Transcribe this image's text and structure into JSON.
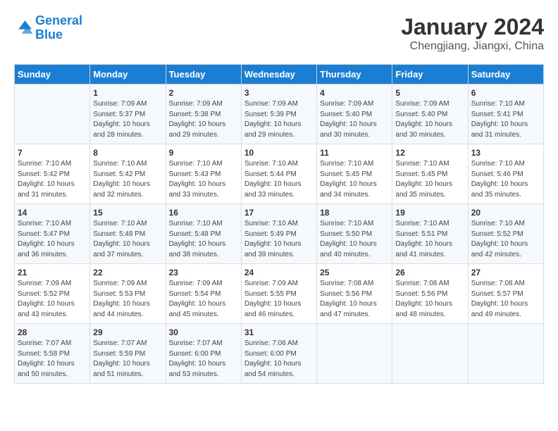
{
  "header": {
    "logo_line1": "General",
    "logo_line2": "Blue",
    "title": "January 2024",
    "subtitle": "Chengjiang, Jiangxi, China"
  },
  "weekdays": [
    "Sunday",
    "Monday",
    "Tuesday",
    "Wednesday",
    "Thursday",
    "Friday",
    "Saturday"
  ],
  "weeks": [
    [
      {
        "day": "",
        "content": ""
      },
      {
        "day": "1",
        "content": "Sunrise: 7:09 AM\nSunset: 5:37 PM\nDaylight: 10 hours\nand 28 minutes."
      },
      {
        "day": "2",
        "content": "Sunrise: 7:09 AM\nSunset: 5:38 PM\nDaylight: 10 hours\nand 29 minutes."
      },
      {
        "day": "3",
        "content": "Sunrise: 7:09 AM\nSunset: 5:39 PM\nDaylight: 10 hours\nand 29 minutes."
      },
      {
        "day": "4",
        "content": "Sunrise: 7:09 AM\nSunset: 5:40 PM\nDaylight: 10 hours\nand 30 minutes."
      },
      {
        "day": "5",
        "content": "Sunrise: 7:09 AM\nSunset: 5:40 PM\nDaylight: 10 hours\nand 30 minutes."
      },
      {
        "day": "6",
        "content": "Sunrise: 7:10 AM\nSunset: 5:41 PM\nDaylight: 10 hours\nand 31 minutes."
      }
    ],
    [
      {
        "day": "7",
        "content": "Sunrise: 7:10 AM\nSunset: 5:42 PM\nDaylight: 10 hours\nand 31 minutes."
      },
      {
        "day": "8",
        "content": "Sunrise: 7:10 AM\nSunset: 5:42 PM\nDaylight: 10 hours\nand 32 minutes."
      },
      {
        "day": "9",
        "content": "Sunrise: 7:10 AM\nSunset: 5:43 PM\nDaylight: 10 hours\nand 33 minutes."
      },
      {
        "day": "10",
        "content": "Sunrise: 7:10 AM\nSunset: 5:44 PM\nDaylight: 10 hours\nand 33 minutes."
      },
      {
        "day": "11",
        "content": "Sunrise: 7:10 AM\nSunset: 5:45 PM\nDaylight: 10 hours\nand 34 minutes."
      },
      {
        "day": "12",
        "content": "Sunrise: 7:10 AM\nSunset: 5:45 PM\nDaylight: 10 hours\nand 35 minutes."
      },
      {
        "day": "13",
        "content": "Sunrise: 7:10 AM\nSunset: 5:46 PM\nDaylight: 10 hours\nand 35 minutes."
      }
    ],
    [
      {
        "day": "14",
        "content": "Sunrise: 7:10 AM\nSunset: 5:47 PM\nDaylight: 10 hours\nand 36 minutes."
      },
      {
        "day": "15",
        "content": "Sunrise: 7:10 AM\nSunset: 5:48 PM\nDaylight: 10 hours\nand 37 minutes."
      },
      {
        "day": "16",
        "content": "Sunrise: 7:10 AM\nSunset: 5:48 PM\nDaylight: 10 hours\nand 38 minutes."
      },
      {
        "day": "17",
        "content": "Sunrise: 7:10 AM\nSunset: 5:49 PM\nDaylight: 10 hours\nand 39 minutes."
      },
      {
        "day": "18",
        "content": "Sunrise: 7:10 AM\nSunset: 5:50 PM\nDaylight: 10 hours\nand 40 minutes."
      },
      {
        "day": "19",
        "content": "Sunrise: 7:10 AM\nSunset: 5:51 PM\nDaylight: 10 hours\nand 41 minutes."
      },
      {
        "day": "20",
        "content": "Sunrise: 7:10 AM\nSunset: 5:52 PM\nDaylight: 10 hours\nand 42 minutes."
      }
    ],
    [
      {
        "day": "21",
        "content": "Sunrise: 7:09 AM\nSunset: 5:52 PM\nDaylight: 10 hours\nand 43 minutes."
      },
      {
        "day": "22",
        "content": "Sunrise: 7:09 AM\nSunset: 5:53 PM\nDaylight: 10 hours\nand 44 minutes."
      },
      {
        "day": "23",
        "content": "Sunrise: 7:09 AM\nSunset: 5:54 PM\nDaylight: 10 hours\nand 45 minutes."
      },
      {
        "day": "24",
        "content": "Sunrise: 7:09 AM\nSunset: 5:55 PM\nDaylight: 10 hours\nand 46 minutes."
      },
      {
        "day": "25",
        "content": "Sunrise: 7:08 AM\nSunset: 5:56 PM\nDaylight: 10 hours\nand 47 minutes."
      },
      {
        "day": "26",
        "content": "Sunrise: 7:08 AM\nSunset: 5:56 PM\nDaylight: 10 hours\nand 48 minutes."
      },
      {
        "day": "27",
        "content": "Sunrise: 7:08 AM\nSunset: 5:57 PM\nDaylight: 10 hours\nand 49 minutes."
      }
    ],
    [
      {
        "day": "28",
        "content": "Sunrise: 7:07 AM\nSunset: 5:58 PM\nDaylight: 10 hours\nand 50 minutes."
      },
      {
        "day": "29",
        "content": "Sunrise: 7:07 AM\nSunset: 5:59 PM\nDaylight: 10 hours\nand 51 minutes."
      },
      {
        "day": "30",
        "content": "Sunrise: 7:07 AM\nSunset: 6:00 PM\nDaylight: 10 hours\nand 53 minutes."
      },
      {
        "day": "31",
        "content": "Sunrise: 7:06 AM\nSunset: 6:00 PM\nDaylight: 10 hours\nand 54 minutes."
      },
      {
        "day": "",
        "content": ""
      },
      {
        "day": "",
        "content": ""
      },
      {
        "day": "",
        "content": ""
      }
    ]
  ]
}
